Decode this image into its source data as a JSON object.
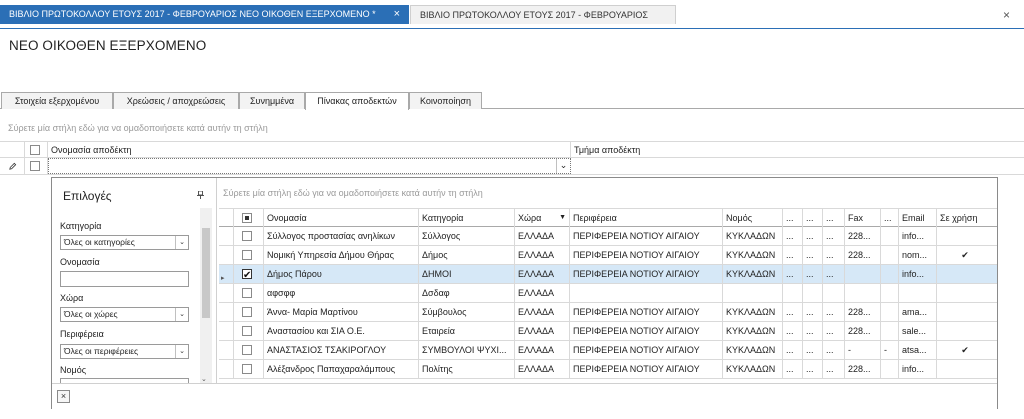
{
  "doc_tabs": [
    {
      "label": "ΒΙΒΛΙΟ ΠΡΩΤΟΚΟΛΛΟΥ ΕΤΟΥΣ 2017 - ΦΕΒΡΟΥΑΡΙΟΣ  ΝΕΟ ΟΙΚΟΘΕΝ ΕΞΕΡΧΟΜΕΝΟ *",
      "active": true
    },
    {
      "label": "ΒΙΒΛΙΟ ΠΡΩΤΟΚΟΛΛΟΥ ΕΤΟΥΣ 2017 - ΦΕΒΡΟΥΑΡΙΟΣ",
      "active": false
    }
  ],
  "page_title": "ΝΕΟ ΟΙΚΟΘΕΝ ΕΞΕΡΧΟΜΕΝΟ",
  "sub_tabs": [
    "Στοιχεία εξερχομένου",
    "Χρεώσεις  / αποχρεώσεις",
    "Συνημμένα",
    "Πίνακας αποδεκτών",
    "Κοινοποίηση"
  ],
  "active_sub_tab": "Πίνακας αποδεκτών",
  "group_hint": "Σύρετε μία στήλη εδώ για να ομαδοποιήσετε κατά αυτήν τη στήλη",
  "main_grid": {
    "columns": [
      "Ονομασία αποδέκτη",
      "Τμήμα αποδέκτη"
    ]
  },
  "filter_panel": {
    "title": "Επιλογές",
    "fields": [
      {
        "label": "Κατηγορία",
        "type": "select",
        "value": "Όλες οι κατηγορίες"
      },
      {
        "label": "Ονομασία",
        "type": "input",
        "value": ""
      },
      {
        "label": "Χώρα",
        "type": "select",
        "value": "Όλες οι χώρες"
      },
      {
        "label": "Περιφέρεια",
        "type": "select",
        "value": "Όλες οι περιφέρειες"
      },
      {
        "label": "Νομός",
        "type": "select",
        "value": ""
      }
    ]
  },
  "inner_grid": {
    "hint": "Σύρετε μία στήλη εδώ για να ομαδοποιήσετε κατά αυτήν τη στήλη",
    "columns": [
      "Ονομασία",
      "Κατηγορία",
      "Χώρα",
      "Περιφέρεια",
      "Νομός",
      "...",
      "...",
      "...",
      "Fax",
      "...",
      "Email",
      "Σε χρήση"
    ],
    "rows": [
      {
        "name": "Σύλλογος προστασίας ανηλίκων",
        "category": "Σύλλογος",
        "country": "ΕΛΛΑΔΑ",
        "region": "ΠΕΡΙΦΕΡΕΙΑ ΝΟΤΙΟΥ ΑΙΓΑΙΟΥ",
        "prefecture": "ΚΥΚΛΑΔΩΝ",
        "c1": "...",
        "c2": "...",
        "c3": "...",
        "fax": "228...",
        "c4": "",
        "email": "info...",
        "in_use": "",
        "checked": false,
        "selected": false
      },
      {
        "name": "Νομική Υπηρεσία Δήμου Θήρας",
        "category": "Δήμος",
        "country": "ΕΛΛΑΔΑ",
        "region": "ΠΕΡΙΦΕΡΕΙΑ ΝΟΤΙΟΥ ΑΙΓΑΙΟΥ",
        "prefecture": "ΚΥΚΛΑΔΩΝ",
        "c1": "...",
        "c2": "...",
        "c3": "...",
        "fax": "228...",
        "c4": "",
        "email": "nom...",
        "in_use": "✔",
        "checked": false,
        "selected": false
      },
      {
        "name": "Δήμος Πάρου",
        "category": "ΔΗΜΟΙ",
        "country": "ΕΛΛΑΔΑ",
        "region": "ΠΕΡΙΦΕΡΕΙΑ ΝΟΤΙΟΥ ΑΙΓΑΙΟΥ",
        "prefecture": "ΚΥΚΛΑΔΩΝ",
        "c1": "...",
        "c2": "...",
        "c3": "...",
        "fax": "",
        "c4": "",
        "email": "info...",
        "in_use": "",
        "checked": true,
        "selected": true
      },
      {
        "name": "αφσφφ",
        "category": "Δσδαφ",
        "country": "ΕΛΛΑΔΑ",
        "region": "",
        "prefecture": "",
        "c1": "",
        "c2": "",
        "c3": "",
        "fax": "",
        "c4": "",
        "email": "",
        "in_use": "",
        "checked": false,
        "selected": false
      },
      {
        "name": "Άννα- Μαρία Μαρτίνου",
        "category": "Σύμβουλος",
        "country": "ΕΛΛΑΔΑ",
        "region": "ΠΕΡΙΦΕΡΕΙΑ ΝΟΤΙΟΥ ΑΙΓΑΙΟΥ",
        "prefecture": "ΚΥΚΛΑΔΩΝ",
        "c1": "...",
        "c2": "...",
        "c3": "...",
        "fax": "228...",
        "c4": "",
        "email": "ama...",
        "in_use": "",
        "checked": false,
        "selected": false
      },
      {
        "name": "Αναστασίου και ΣΙΑ Ο.Ε.",
        "category": "Εταιρεία",
        "country": "ΕΛΛΑΔΑ",
        "region": "ΠΕΡΙΦΕΡΕΙΑ ΝΟΤΙΟΥ ΑΙΓΑΙΟΥ",
        "prefecture": "ΚΥΚΛΑΔΩΝ",
        "c1": "...",
        "c2": "...",
        "c3": "...",
        "fax": "228...",
        "c4": "",
        "email": "sale...",
        "in_use": "",
        "checked": false,
        "selected": false
      },
      {
        "name": "ΑΝΑΣΤΑΣΙΟΣ ΤΣΑΚΙΡΟΓΛΟΥ",
        "category": "ΣΥΜΒΟΥΛΟΙ ΨΥΧΙ...",
        "country": "ΕΛΛΑΔΑ",
        "region": "ΠΕΡΙΦΕΡΕΙΑ ΝΟΤΙΟΥ ΑΙΓΑΙΟΥ",
        "prefecture": "ΚΥΚΛΑΔΩΝ",
        "c1": "...",
        "c2": "...",
        "c3": "...",
        "fax": "-",
        "c4": "-",
        "email": "atsa...",
        "in_use": "✔",
        "checked": false,
        "selected": false
      },
      {
        "name": "Αλέξανδρος Παπαχαραλάμπους",
        "category": "Πολίτης",
        "country": "ΕΛΛΑΔΑ",
        "region": "ΠΕΡΙΦΕΡΕΙΑ ΝΟΤΙΟΥ ΑΙΓΑΙΟΥ",
        "prefecture": "ΚΥΚΛΑΔΩΝ",
        "c1": "...",
        "c2": "...",
        "c3": "...",
        "fax": "228...",
        "c4": "",
        "email": "info...",
        "in_use": "",
        "checked": false,
        "selected": false
      }
    ]
  },
  "icons": {
    "tab_close": "×",
    "window_close": "×",
    "pin": "pin-icon",
    "dropdown_arrow": "⌄",
    "popup_close": "×",
    "row_indicator": "▸",
    "edit": "pencil-icon"
  },
  "colors": {
    "accent": "#2b6fb6",
    "selected_row": "#d6e8f7"
  }
}
